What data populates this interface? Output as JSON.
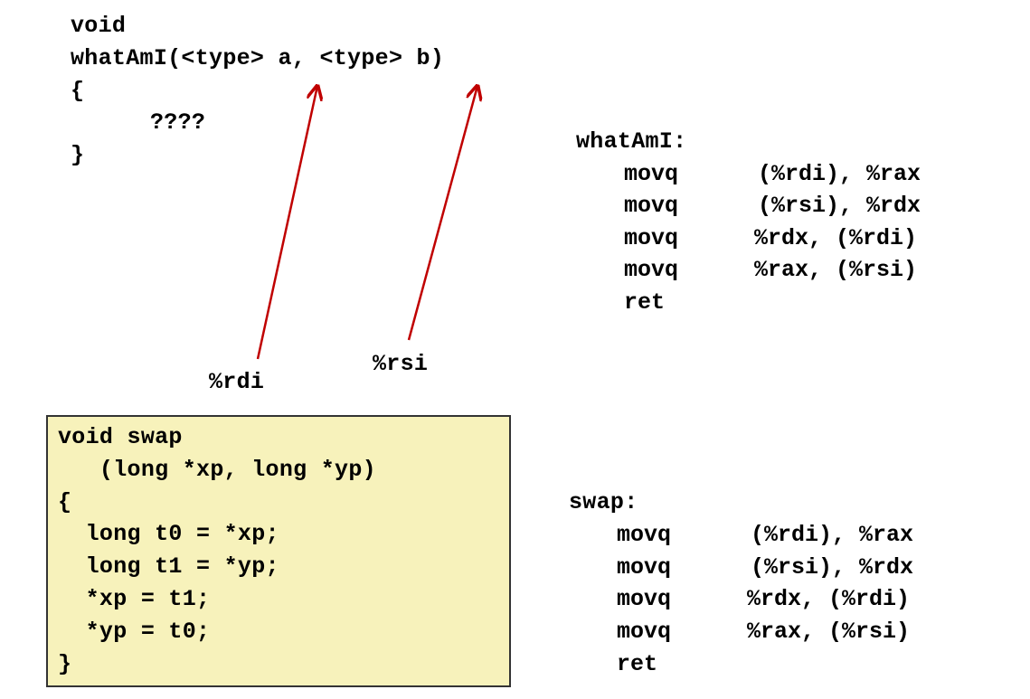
{
  "colors": {
    "arrow": "#c00000",
    "box_fill": "#f7f2bb"
  },
  "mystery_code": {
    "return_type": "void",
    "signature": "whatAmI(<type> a, <type> b)",
    "open_brace": "{",
    "body": "????",
    "close_brace": "}"
  },
  "register_labels": {
    "a": "%rdi",
    "b": "%rsi"
  },
  "whatami_asm": {
    "label": "whatAmI:",
    "instructions": [
      {
        "op": "movq",
        "args": "(%rdi), %rax"
      },
      {
        "op": "movq",
        "args": "(%rsi), %rdx"
      },
      {
        "op": "movq",
        "args": "%rdx, (%rdi)"
      },
      {
        "op": "movq",
        "args": "%rax, (%rsi)"
      },
      {
        "op": "ret",
        "args": ""
      }
    ]
  },
  "swap_code": {
    "lines": [
      "void swap",
      "   (long *xp, long *yp)",
      "{",
      "  long t0 = *xp;",
      "  long t1 = *yp;",
      "  *xp = t1;",
      "  *yp = t0;",
      "}"
    ]
  },
  "swap_asm": {
    "label": "swap:",
    "instructions": [
      {
        "op": "movq",
        "args": "(%rdi), %rax"
      },
      {
        "op": "movq",
        "args": "(%rsi), %rdx"
      },
      {
        "op": "movq",
        "args": "%rdx, (%rdi)"
      },
      {
        "op": "movq",
        "args": "%rax, (%rsi)"
      },
      {
        "op": "ret",
        "args": ""
      }
    ]
  }
}
